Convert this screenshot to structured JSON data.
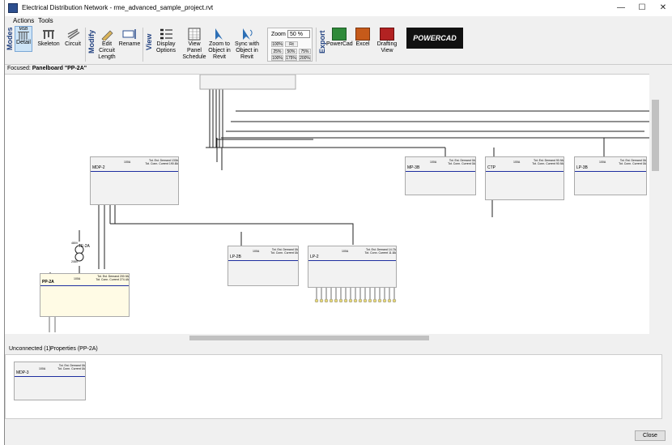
{
  "window": {
    "title": "Electrical Distribution Network - rme_advanced_sample_project.rvt",
    "minimize": "—",
    "maximize": "☐",
    "close": "✕"
  },
  "menu": {
    "actions": "Actions",
    "tools": "Tools"
  },
  "ribbon": {
    "modes_label": "Modes",
    "modify_label": "Modify",
    "view_label": "View",
    "export_label": "Export",
    "detail": "Detail",
    "detail_tag": "MSB",
    "skeleton": "Skeleton",
    "circuit": "Circuit",
    "edit_circuit_length": "Edit Circuit Length",
    "rename": "Rename",
    "display_options": "Display Options",
    "view_panel_schedule": "View Panel Schedule",
    "zoom_to_object": "Zoom to Object in Revit",
    "sync_with_object": "Sync with Object in Revit",
    "zoom_label": "Zoom",
    "zoom_value": "50 %",
    "zoom_options": [
      "100%",
      "Fit",
      "25%",
      "50%",
      "75%",
      "100%",
      "175%",
      "200%"
    ],
    "powercad": "PowerCad",
    "excel": "Excel",
    "drafting_view": "Drafting View",
    "powercad_logo": "POWERCAD"
  },
  "focused": {
    "prefix": "Focused:",
    "value": "Panelboard \"PP-2A\""
  },
  "panels": [
    {
      "name": "MDP-2",
      "amp": "100A",
      "demand": "Tot. Est. Demand 133A",
      "current": "Tot. Conn. Current 190.8A"
    },
    {
      "name": "MP-3B",
      "amp": "100A",
      "demand": "Tot. Est. Demand 0A",
      "current": "Tot. Conn. Current 0A"
    },
    {
      "name": "CTP",
      "amp": "100A",
      "demand": "Tot. Est. Demand 90.9A",
      "current": "Tot. Conn. Current 90.9A"
    },
    {
      "name": "LP-3B",
      "amp": "100A",
      "demand": "Tot. Est. Demand 0A",
      "current": "Tot. Conn. Current 0A"
    },
    {
      "name": "LP-2B",
      "amp": "100A",
      "demand": "Tot. Est. Demand 0A",
      "current": "Tot. Conn. Current 0A"
    },
    {
      "name": "LP-2",
      "amp": "100A",
      "demand": "Tot. Est. Demand 14.7A",
      "current": "Tot. Conn. Current 11.8A"
    },
    {
      "name": "PP-2A",
      "amp": "100A",
      "demand": "Tot. Est. Demand 200.9A",
      "current": "Tot. Conn. Current 274.4A"
    },
    {
      "name": "MDP-3",
      "amp": "100A",
      "demand": "Tot. Est. Demand 0A",
      "current": "Tot. Conn. Current 0A"
    }
  ],
  "transformer": {
    "name": "TF-2A",
    "primary": "480V",
    "secondary": "208V"
  },
  "tabs": {
    "unconnected": "Unconnected (1)",
    "properties": "Properties (PP-2A)"
  },
  "close_button": "Close",
  "colors": {
    "bus": "#1e2fa0",
    "selected_panel": "#fffbe5",
    "title_accent": "#1f3f7f"
  }
}
